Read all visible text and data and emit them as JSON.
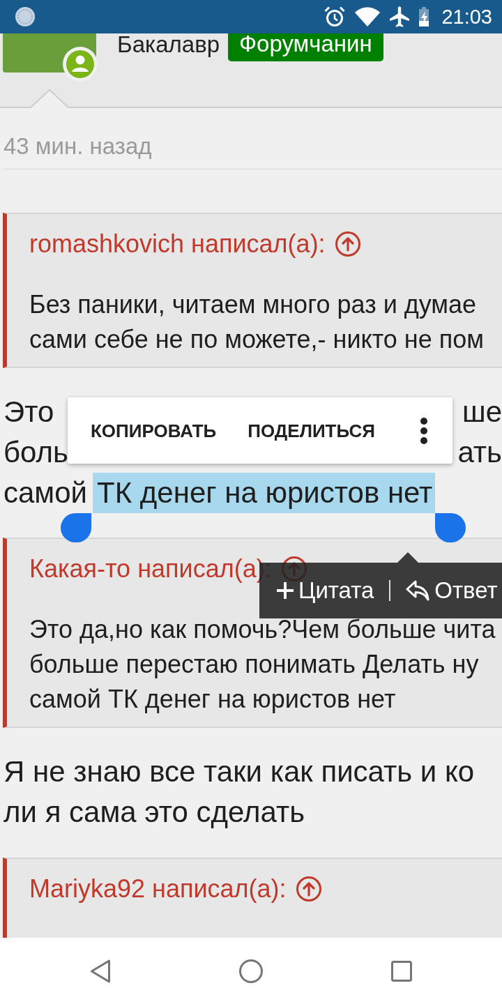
{
  "status_bar": {
    "time": "21:03"
  },
  "author": {
    "rank": "Бакалавр",
    "group": "Форумчанин"
  },
  "post_time": "43 мин. назад",
  "blocks": [
    {
      "kind": "quote",
      "author": "romashkovich написал(а):",
      "text": "Без паники, читаем много раз и думае\nсами себе не по можете,- никто не пом"
    },
    {
      "kind": "selection",
      "lines": [
        {
          "kind": "split",
          "left": "Это",
          "right": "ше"
        },
        {
          "kind": "split",
          "left": "боль",
          "right": "ать"
        },
        {
          "kind": "full",
          "segments": [
            {
              "text": "самой",
              "selected": false
            },
            {
              "text": "ТК денег на юристов нет",
              "selected": true
            }
          ]
        }
      ],
      "menu": {
        "items": [
          "КОПИРОВАТЬ",
          "ПОДЕЛИТЬСЯ"
        ]
      }
    },
    {
      "kind": "quote",
      "author": "Какая-то написал(а):",
      "text": "Это да,но как помочь?Чем больше чита\nбольше перестаю понимать Делать ну\nсамой ТК денег на юристов нет",
      "popup": {
        "items": [
          {
            "kind": "quote",
            "label": "Цитата"
          },
          {
            "kind": "reply",
            "label": "Ответ"
          }
        ]
      }
    },
    {
      "kind": "paragraph",
      "text": "Я не знаю все таки как писать и ко\nли я сама это сделать"
    },
    {
      "kind": "quote",
      "author": "Mariyka92 написал(а):"
    }
  ]
}
